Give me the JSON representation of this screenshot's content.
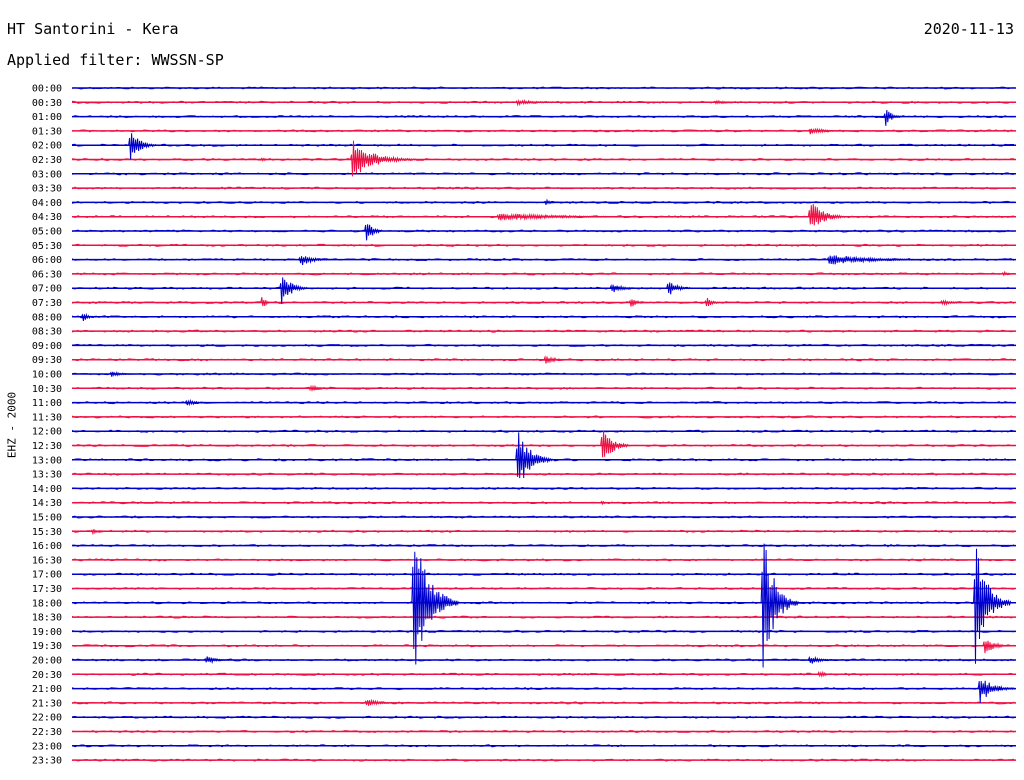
{
  "header": {
    "title": "HT Santorini - Kera",
    "date": "2020-11-13",
    "filter_label": "Applied filter: WWSSN-SP"
  },
  "chart_data": {
    "type": "line",
    "title": "HT Santorini - Kera",
    "ylabel": "EHZ - 2000",
    "xlabel": "",
    "rows": [
      "00:00",
      "00:30",
      "01:00",
      "01:30",
      "02:00",
      "02:30",
      "03:00",
      "03:30",
      "04:00",
      "04:30",
      "05:00",
      "05:30",
      "06:00",
      "06:30",
      "07:00",
      "07:30",
      "08:00",
      "08:30",
      "09:00",
      "09:30",
      "10:00",
      "10:30",
      "11:00",
      "11:30",
      "12:00",
      "12:30",
      "13:00",
      "13:30",
      "14:00",
      "14:30",
      "15:00",
      "15:30",
      "16:00",
      "16:30",
      "17:00",
      "17:30",
      "18:00",
      "18:30",
      "19:00",
      "19:30",
      "20:00",
      "20:30",
      "21:00",
      "21:30",
      "22:00",
      "22:30",
      "23:00",
      "23:30"
    ],
    "colors": [
      "#0000cc",
      "#ee1144"
    ],
    "minutes_per_row": 30,
    "events": [
      {
        "row": 1,
        "t": 0.47,
        "amp": 3,
        "dur": 0.07
      },
      {
        "row": 1,
        "t": 0.68,
        "amp": 3,
        "dur": 0.03
      },
      {
        "row": 2,
        "t": 0.86,
        "amp": 14,
        "dur": 0.02
      },
      {
        "row": 3,
        "t": 0.78,
        "amp": 5,
        "dur": 0.04
      },
      {
        "row": 4,
        "t": 0.06,
        "amp": 22,
        "dur": 0.03
      },
      {
        "row": 5,
        "t": 0.2,
        "amp": 4,
        "dur": 0.01
      },
      {
        "row": 5,
        "t": 0.295,
        "amp": 22,
        "dur": 0.07
      },
      {
        "row": 8,
        "t": 0.5,
        "amp": 4,
        "dur": 0.02
      },
      {
        "row": 9,
        "t": 0.45,
        "amp": 4,
        "dur": 0.2
      },
      {
        "row": 9,
        "t": 0.78,
        "amp": 22,
        "dur": 0.04
      },
      {
        "row": 10,
        "t": 0.31,
        "amp": 20,
        "dur": 0.02
      },
      {
        "row": 12,
        "t": 0.24,
        "amp": 8,
        "dur": 0.04
      },
      {
        "row": 12,
        "t": 0.8,
        "amp": 6,
        "dur": 0.13
      },
      {
        "row": 13,
        "t": 0.985,
        "amp": 4,
        "dur": 0.015
      },
      {
        "row": 14,
        "t": 0.22,
        "amp": 24,
        "dur": 0.03
      },
      {
        "row": 14,
        "t": 0.57,
        "amp": 8,
        "dur": 0.03
      },
      {
        "row": 14,
        "t": 0.63,
        "amp": 10,
        "dur": 0.03
      },
      {
        "row": 15,
        "t": 0.2,
        "amp": 16,
        "dur": 0.01
      },
      {
        "row": 15,
        "t": 0.59,
        "amp": 8,
        "dur": 0.02
      },
      {
        "row": 15,
        "t": 0.67,
        "amp": 8,
        "dur": 0.02
      },
      {
        "row": 15,
        "t": 0.92,
        "amp": 4,
        "dur": 0.03
      },
      {
        "row": 16,
        "t": 0.01,
        "amp": 6,
        "dur": 0.02
      },
      {
        "row": 19,
        "t": 0.5,
        "amp": 6,
        "dur": 0.03
      },
      {
        "row": 20,
        "t": 0.04,
        "amp": 4,
        "dur": 0.03
      },
      {
        "row": 21,
        "t": 0.25,
        "amp": 5,
        "dur": 0.03
      },
      {
        "row": 22,
        "t": 0.12,
        "amp": 4,
        "dur": 0.03
      },
      {
        "row": 25,
        "t": 0.56,
        "amp": 30,
        "dur": 0.03
      },
      {
        "row": 26,
        "t": 0.47,
        "amp": 40,
        "dur": 0.04
      },
      {
        "row": 29,
        "t": 0.56,
        "amp": 4,
        "dur": 0.01
      },
      {
        "row": 31,
        "t": 0.02,
        "amp": 4,
        "dur": 0.02
      },
      {
        "row": 36,
        "t": 0.36,
        "amp": 90,
        "dur": 0.05
      },
      {
        "row": 36,
        "t": 0.73,
        "amp": 85,
        "dur": 0.04
      },
      {
        "row": 36,
        "t": 0.955,
        "amp": 75,
        "dur": 0.04
      },
      {
        "row": 39,
        "t": 0.965,
        "amp": 12,
        "dur": 0.03
      },
      {
        "row": 40,
        "t": 0.14,
        "amp": 6,
        "dur": 0.03
      },
      {
        "row": 40,
        "t": 0.78,
        "amp": 6,
        "dur": 0.03
      },
      {
        "row": 41,
        "t": 0.79,
        "amp": 5,
        "dur": 0.02
      },
      {
        "row": 42,
        "t": 0.96,
        "amp": 18,
        "dur": 0.04
      },
      {
        "row": 43,
        "t": 0.31,
        "amp": 4,
        "dur": 0.05
      }
    ]
  }
}
